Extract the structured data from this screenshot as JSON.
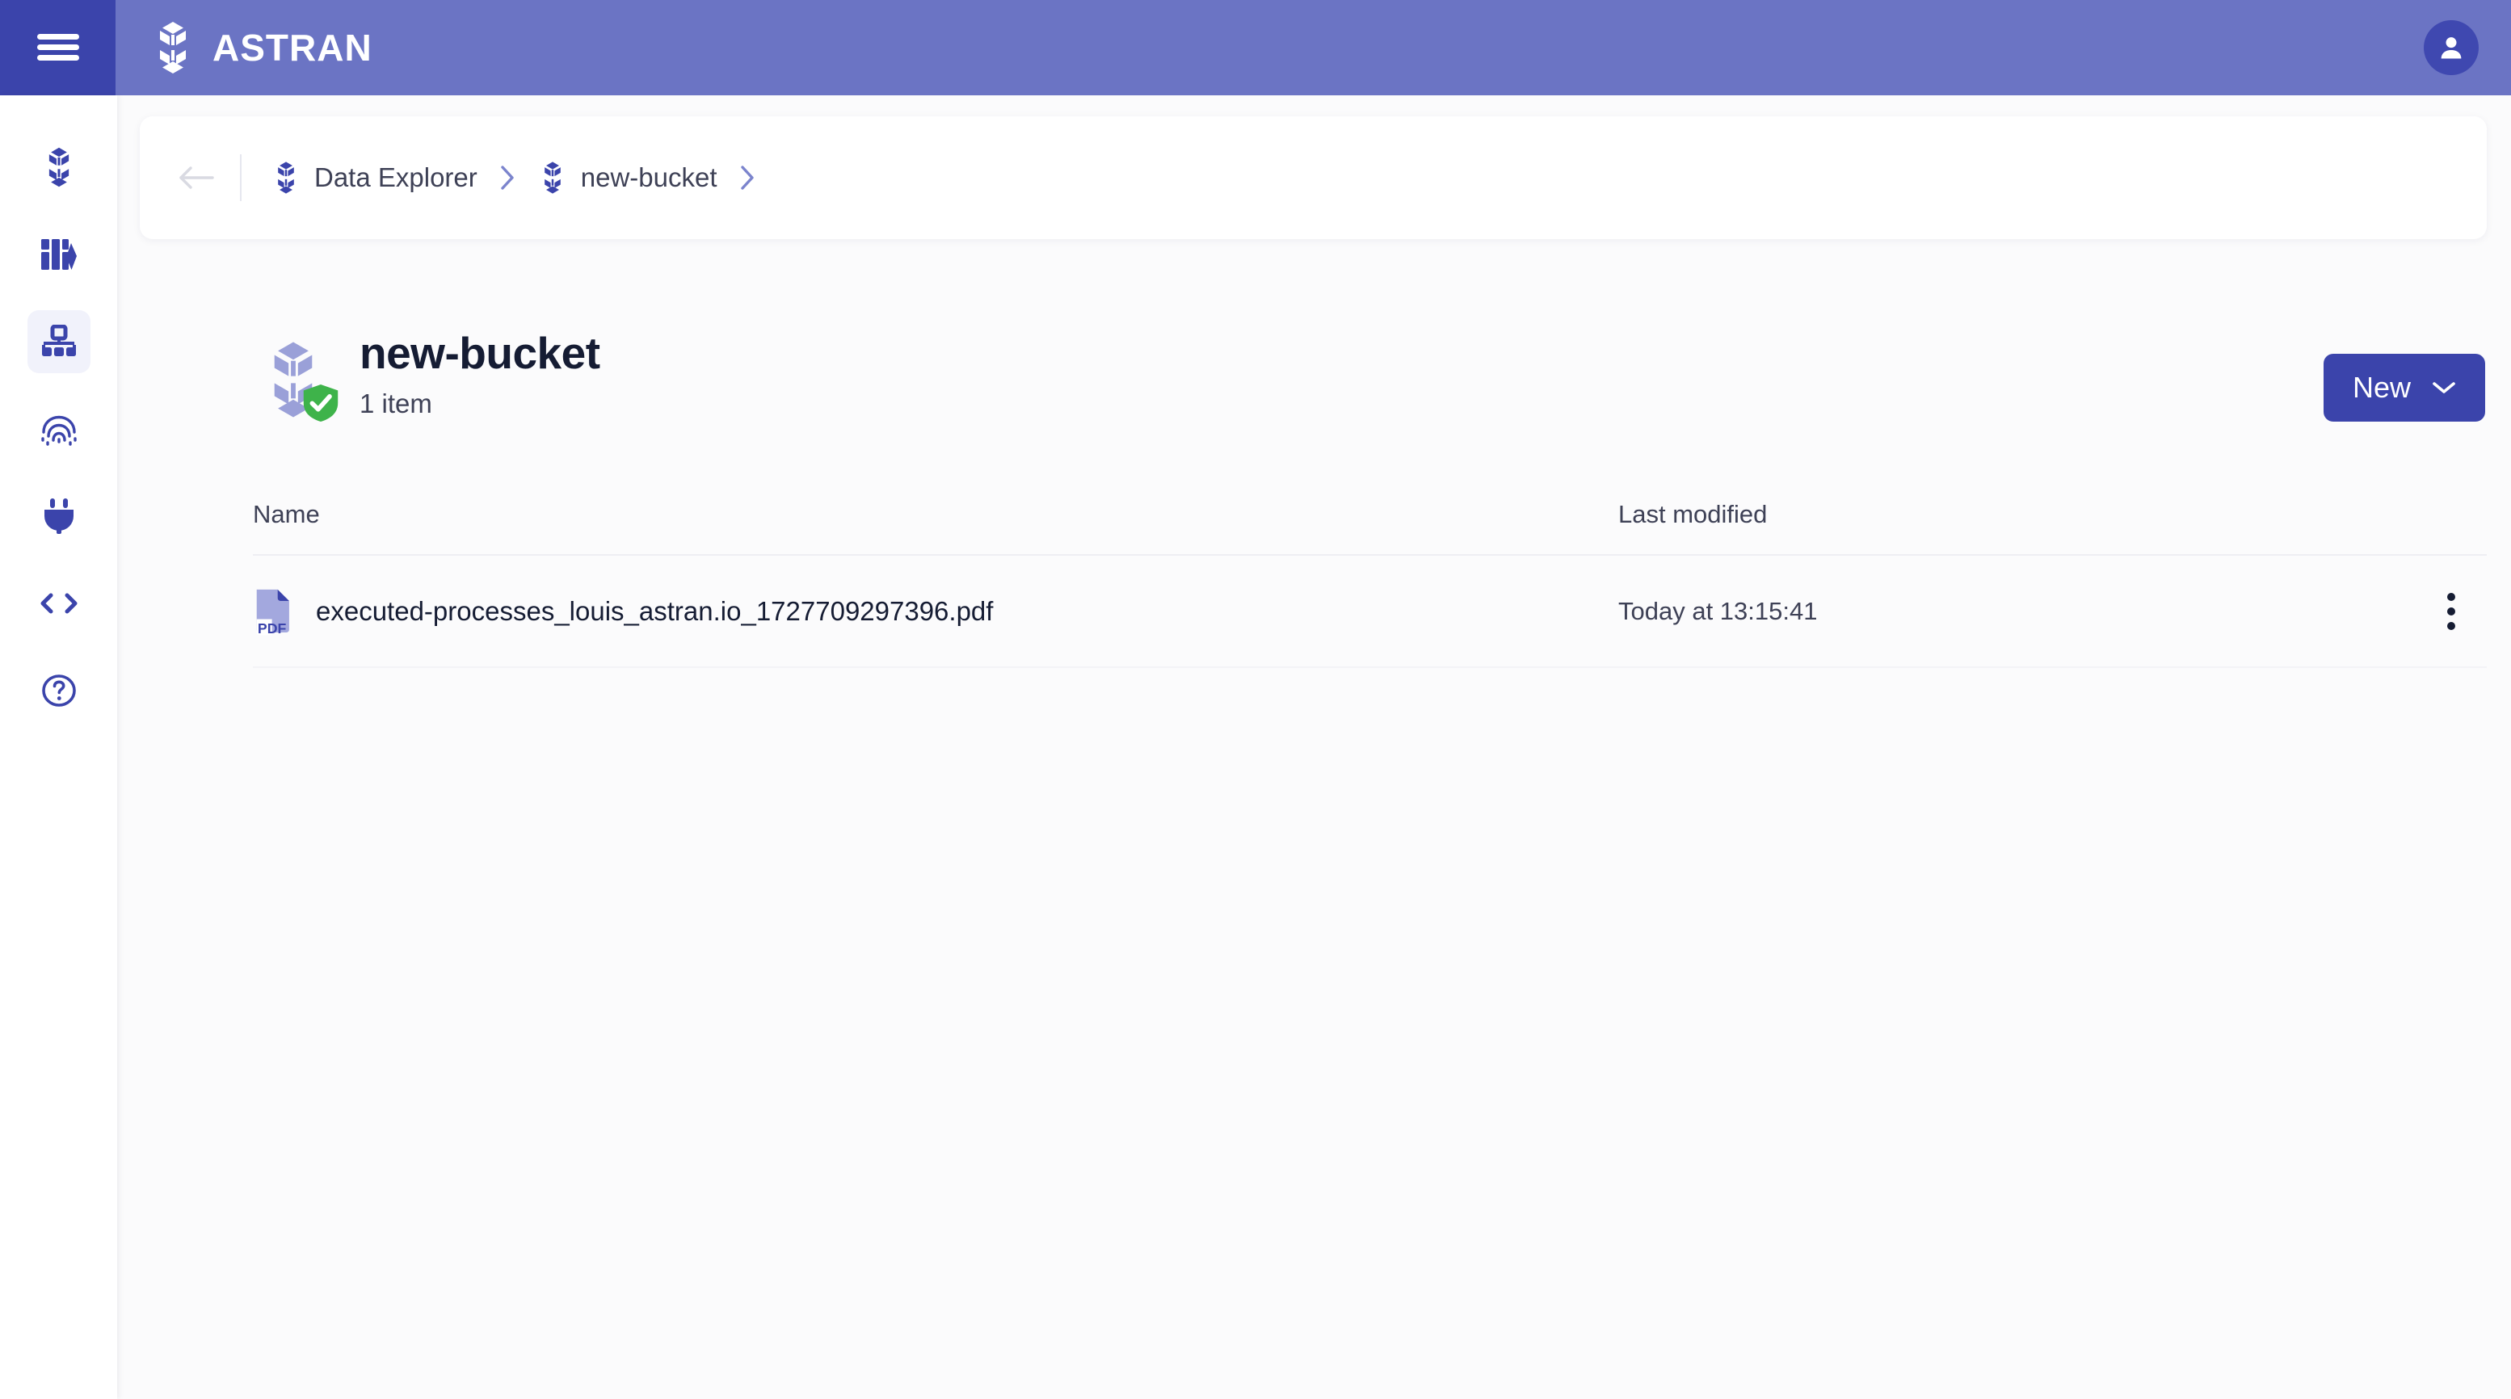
{
  "header": {
    "menu_icon": "hamburger-icon",
    "brand_icon": "astran-hexagon-logo-icon",
    "brand_name": "ASTRAN",
    "avatar_icon": "user-avatar-icon",
    "bg_color": "#6b74c4",
    "menu_bg_color": "#3b44ab"
  },
  "sidebar": {
    "items": [
      {
        "icon": "astran-hexagon-icon",
        "active": false
      },
      {
        "icon": "library-books-icon",
        "active": false
      },
      {
        "icon": "sitemap-icon",
        "active": true
      },
      {
        "icon": "fingerprint-icon",
        "active": false
      },
      {
        "icon": "plug-connector-icon",
        "active": false
      },
      {
        "icon": "code-brackets-icon",
        "active": false
      },
      {
        "icon": "help-circle-icon",
        "active": false
      }
    ],
    "icon_color": "#3b44ab",
    "active_bg": "#f1f2fb"
  },
  "breadcrumb": {
    "back_icon": "arrow-left-icon",
    "items": [
      {
        "icon": "astran-hexagon-icon",
        "label": "Data Explorer"
      },
      {
        "icon": "astran-hexagon-icon",
        "label": "new-bucket"
      }
    ],
    "chevron_icon": "chevron-right-icon"
  },
  "title_block": {
    "bucket_icon": "bucket-hexagon-icon",
    "status_badge_icon": "shield-check-icon",
    "status_badge_color": "#3eb34a",
    "title": "new-bucket",
    "subtitle": "1 item"
  },
  "toolbar": {
    "new_label": "New",
    "new_chevron_icon": "chevron-down-icon",
    "new_bg_color": "#3b44ab"
  },
  "table": {
    "columns": [
      {
        "key": "name",
        "label": "Name"
      },
      {
        "key": "modified",
        "label": "Last modified"
      }
    ],
    "rows": [
      {
        "file_icon": "pdf-file-icon",
        "name": "executed-processes_louis_astran.io_1727709297396.pdf",
        "modified": "Today at 13:15:41",
        "actions_icon": "kebab-menu-icon"
      }
    ]
  }
}
